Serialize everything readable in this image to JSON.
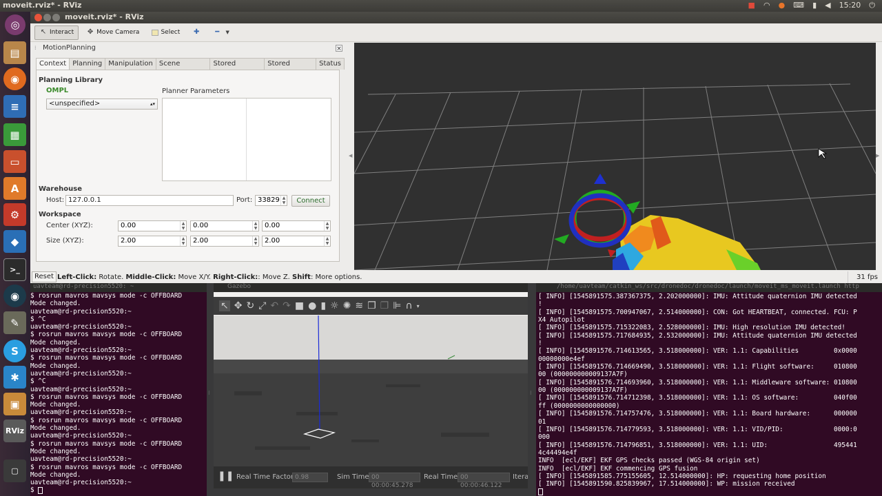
{
  "topbar": {
    "title": "moveit.rviz* - RViz",
    "clock": "15:20"
  },
  "rviz": {
    "window_title": "moveit.rviz* - RViz",
    "toolbar": {
      "interact": "Interact",
      "move_camera": "Move Camera",
      "select": "Select"
    },
    "panel": {
      "title": "MotionPlanning",
      "tabs": [
        "Context",
        "Planning",
        "Manipulation",
        "Scene Objects",
        "Stored Scenes",
        "Stored States",
        "Status"
      ],
      "planning_library_label": "Planning Library",
      "planner_name": "OMPL",
      "planner_select": "<unspecified>",
      "planner_params_label": "Planner Parameters",
      "warehouse_label": "Warehouse",
      "host_label": "Host:",
      "host_value": "127.0.0.1",
      "port_label": "Port:",
      "port_value": "33829",
      "connect_label": "Connect",
      "workspace_label": "Workspace",
      "center_label": "Center (XYZ):",
      "center_values": [
        "0.00",
        "0.00",
        "0.00"
      ],
      "size_label": "Size (XYZ):",
      "size_values": [
        "2.00",
        "2.00",
        "2.00"
      ]
    },
    "status": {
      "reset": "Reset",
      "hint_parts": [
        "Left-Click:",
        " Rotate. ",
        "Middle-Click:",
        " Move X/Y. ",
        "Right-Click:",
        ": Move Z. ",
        "Shift",
        ": More options."
      ],
      "fps": "31 fps"
    }
  },
  "term1": {
    "header": "uavteam@rd-precision5520: ~",
    "lines": [
      "$ rosrun mavros mavsys mode -c OFFBOARD",
      "Mode changed.",
      "uavteam@rd-precision5520:~",
      "$ ^C",
      "uavteam@rd-precision5520:~",
      "$ rosrun mavros mavsys mode -c OFFBOARD",
      "Mode changed.",
      "uavteam@rd-precision5520:~",
      "$ rosrun mavros mavsys mode -c OFFBOARD",
      "Mode changed.",
      "uavteam@rd-precision5520:~",
      "$ ^C",
      "uavteam@rd-precision5520:~",
      "$ rosrun mavros mavsys mode -c OFFBOARD",
      "Mode changed.",
      "uavteam@rd-precision5520:~",
      "$ rosrun mavros mavsys mode -c OFFBOARD",
      "Mode changed.",
      "uavteam@rd-precision5520:~",
      "$ rosrun mavros mavsys mode -c OFFBOARD",
      "Mode changed.",
      "uavteam@rd-precision5520:~",
      "$ rosrun mavros mavsys mode -c OFFBOARD",
      "Mode changed.",
      "uavteam@rd-precision5520:~"
    ],
    "prompt": "$ "
  },
  "gazebo": {
    "title": "Gazebo",
    "rtf_label": "Real Time Factor:",
    "rtf_value": "0.98",
    "sim_label": "Sim Time:",
    "sim_value": "00 00:00:45.278",
    "real_label": "Real Time:",
    "real_value": "00 00:00:46.122",
    "iter_label": "Itera"
  },
  "term2": {
    "header": "/home/uavteam/catkin_ws/src/dronedoc/dronedoc/launch/moveit_ms_moveit.launch http",
    "lines": [
      "[ INFO] [1545891575.387367375, 2.202000000]: IMU: Attitude quaternion IMU detected",
      "!",
      "[ INFO] [1545891575.700947067, 2.514000000]: CON: Got HEARTBEAT, connected. FCU: P",
      "X4 Autopilot",
      "[ INFO] [1545891575.715322083, 2.528000000]: IMU: High resolution IMU detected!",
      "[ INFO] [1545891575.717684935, 2.532000000]: IMU: Attitude quaternion IMU detected",
      "!",
      "[ INFO] [1545891576.714613565, 3.518000000]: VER: 1.1: Capabilities         0x0000",
      "00000000e4ef",
      "[ INFO] [1545891576.714669490, 3.518000000]: VER: 1.1: Flight software:     010800",
      "00 (000000000009137A7F)",
      "[ INFO] [1545891576.714693960, 3.518000000]: VER: 1.1: Middleware software: 010800",
      "00 (000000000009137A7F)",
      "[ INFO] [1545891576.714712398, 3.518000000]: VER: 1.1: OS software:         040f00",
      "ff (0000000000000000)",
      "[ INFO] [1545891576.714757476, 3.518000000]: VER: 1.1: Board hardware:      000000",
      "01",
      "[ INFO] [1545891576.714779593, 3.518000000]: VER: 1.1: VID/PID:             0000:0",
      "000",
      "[ INFO] [1545891576.714796851, 3.518000000]: VER: 1.1: UID:                 495441",
      "4c44494e4f",
      "INFO  [ecl/EKF] EKF GPS checks passed (WGS-84 origin set)",
      "INFO  [ecl/EKF] EKF commencing GPS fusion",
      "[ INFO] [1545891585.775155605, 12.514000000]: HP: requesting home position",
      "[ INFO] [1545891590.825839967, 17.514000000]: WP: mission received"
    ]
  }
}
